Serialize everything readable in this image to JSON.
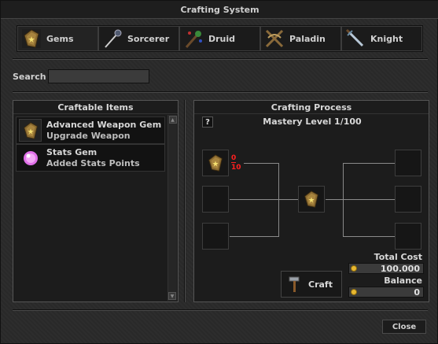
{
  "window": {
    "title": "Crafting System"
  },
  "tabs": [
    {
      "label": "Gems",
      "icon": "gem-icon",
      "active": true
    },
    {
      "label": "Sorcerer",
      "icon": "wand-icon",
      "active": false
    },
    {
      "label": "Druid",
      "icon": "rod-icon",
      "active": false
    },
    {
      "label": "Paladin",
      "icon": "crossbow-icon",
      "active": false
    },
    {
      "label": "Knight",
      "icon": "sword-icon",
      "active": false
    }
  ],
  "search": {
    "label": "Search",
    "value": ""
  },
  "craftable": {
    "title": "Craftable Items",
    "items": [
      {
        "name": "Advanced Weapon Gem",
        "desc": "Upgrade Weapon",
        "icon": "gem-icon"
      },
      {
        "name": "Stats Gem",
        "desc": "Added Stats Points",
        "icon": "pink-orb-icon"
      }
    ]
  },
  "process": {
    "title": "Crafting Process",
    "help": "?",
    "mastery": "Mastery Level 1/100",
    "ingredient": {
      "have": "0",
      "need": "10"
    },
    "total_cost_label": "Total Cost",
    "total_cost": "100.000",
    "balance_label": "Balance",
    "balance": "0",
    "craft_label": "Craft"
  },
  "footer": {
    "close_label": "Close"
  },
  "colors": {
    "accent_gold": "#e8b830",
    "missing_red": "#ff2020"
  }
}
